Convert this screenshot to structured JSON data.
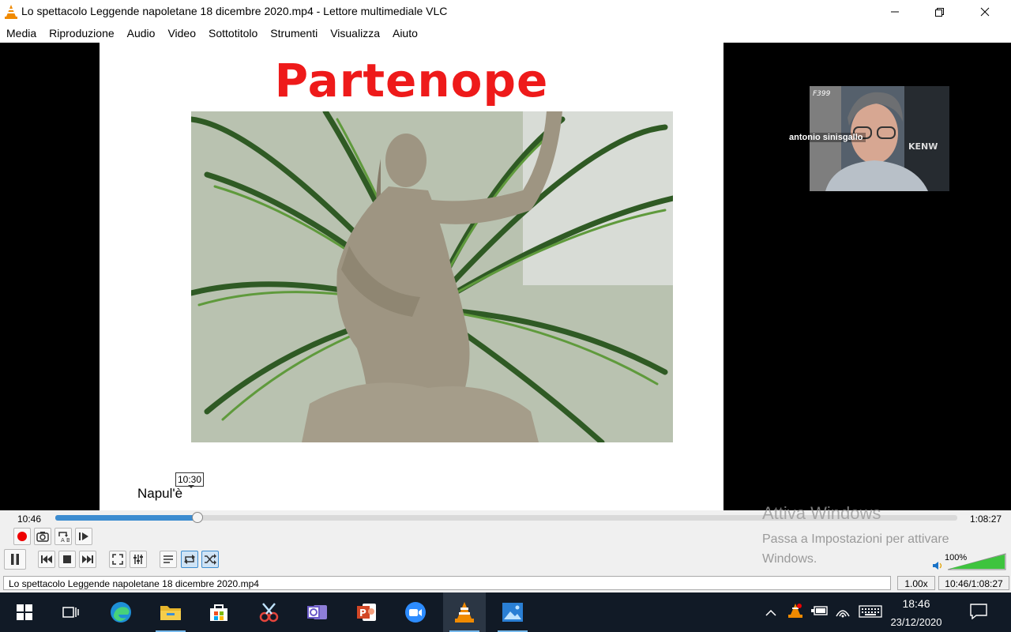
{
  "window": {
    "title": "Lo spettacolo Leggende napoletane 18 dicembre 2020.mp4 - Lettore multimediale VLC",
    "minimize_icon": "minimize-icon",
    "maximize_icon": "maximize-icon",
    "close_icon": "close-icon"
  },
  "menu": {
    "items": [
      "Media",
      "Riproduzione",
      "Audio",
      "Video",
      "Sottotitolo",
      "Strumenti",
      "Visualizza",
      "Aiuto"
    ]
  },
  "video": {
    "slide_title": "Partenope",
    "slide_caption": "Napul'è",
    "participant_name": "antonio sinisgallo",
    "seek_tooltip": "10:30"
  },
  "playback": {
    "elapsed": "10:46",
    "total": "1:08:27",
    "progress_fraction": 0.157,
    "volume": "100%",
    "volume_fraction": 1.0
  },
  "watermark": {
    "line1": "Attiva Windows",
    "line2": "Passa a Impostazioni per attivare Windows."
  },
  "status": {
    "filename": "Lo spettacolo Leggende napoletane 18 dicembre 2020.mp4",
    "speed": "1.00x",
    "time": "10:46/1:08:27"
  },
  "taskbar": {
    "apps": [
      "start-icon",
      "task-view-icon",
      "edge-icon",
      "file-explorer-icon",
      "store-icon",
      "snipping-tool-icon",
      "outlook-icon",
      "powerpoint-icon",
      "zoom-icon",
      "vlc-icon",
      "photos-icon"
    ],
    "clock_time": "18:46",
    "clock_date": "23/12/2020"
  },
  "colors": {
    "slide_title": "#ee1a1a",
    "seek_fill": "#3c8cd0",
    "taskbar": "#111a26",
    "vlc_orange": "#f08a00"
  }
}
